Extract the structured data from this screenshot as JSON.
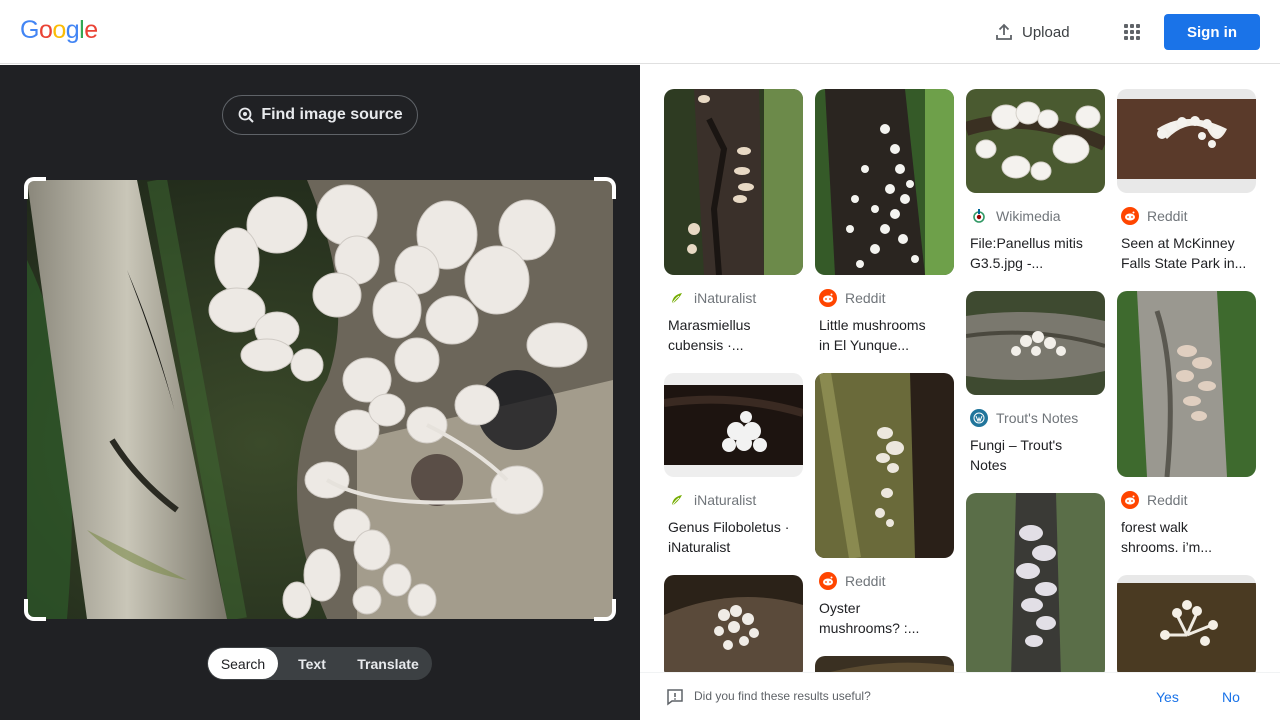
{
  "header": {
    "logo_letters": [
      "G",
      "o",
      "o",
      "g",
      "l",
      "e"
    ],
    "upload_label": "Upload",
    "signin_label": "Sign in"
  },
  "left": {
    "find_source_label": "Find image source",
    "tabs": [
      "Search",
      "Text",
      "Translate"
    ],
    "active_tab": "Search"
  },
  "results": [
    [
      {
        "source": "iNaturalist",
        "title_lines": [
          "Marasmiellus",
          "cubensis ·..."
        ],
        "icon": "inaturalist-icon"
      },
      {
        "source": "iNaturalist",
        "title_lines": [
          "Genus Filoboletus ·",
          "iNaturalist"
        ],
        "icon": "inaturalist-icon"
      },
      {
        "source": "",
        "title_lines": [],
        "icon": ""
      }
    ],
    [
      {
        "source": "Reddit",
        "title_lines": [
          "Little mushrooms",
          "in El Yunque..."
        ],
        "icon": "reddit-icon"
      },
      {
        "source": "Reddit",
        "title_lines": [
          "Oyster",
          "mushrooms? :..."
        ],
        "icon": "reddit-icon"
      },
      {
        "source": "",
        "title_lines": [],
        "icon": ""
      }
    ],
    [
      {
        "source": "Wikimedia",
        "title_lines": [
          "File:Panellus mitis",
          "G3.5.jpg -..."
        ],
        "icon": "wikimedia-icon"
      },
      {
        "source": "Trout's Notes",
        "title_lines": [
          "Fungi – Trout's",
          "Notes"
        ],
        "icon": "wordpress-icon"
      },
      {
        "source": "",
        "title_lines": [],
        "icon": ""
      }
    ],
    [
      {
        "source": "Reddit",
        "title_lines": [
          "Seen at McKinney",
          "Falls State Park in..."
        ],
        "icon": "reddit-icon"
      },
      {
        "source": "Reddit",
        "title_lines": [
          "forest walk",
          "shrooms. i’m..."
        ],
        "icon": "reddit-icon"
      },
      {
        "source": "",
        "title_lines": [],
        "icon": ""
      }
    ]
  ],
  "feedback": {
    "question": "Did you find these results useful?",
    "yes": "Yes",
    "no": "No"
  },
  "colors": {
    "google_blue": "#4285f4",
    "google_red": "#ea4335",
    "google_yellow": "#fbbc05",
    "google_green": "#34a853",
    "signin_bg": "#1a73e8",
    "panel_dark": "#202124",
    "reddit": "#ff4500",
    "inaturalist": "#74ac00"
  }
}
